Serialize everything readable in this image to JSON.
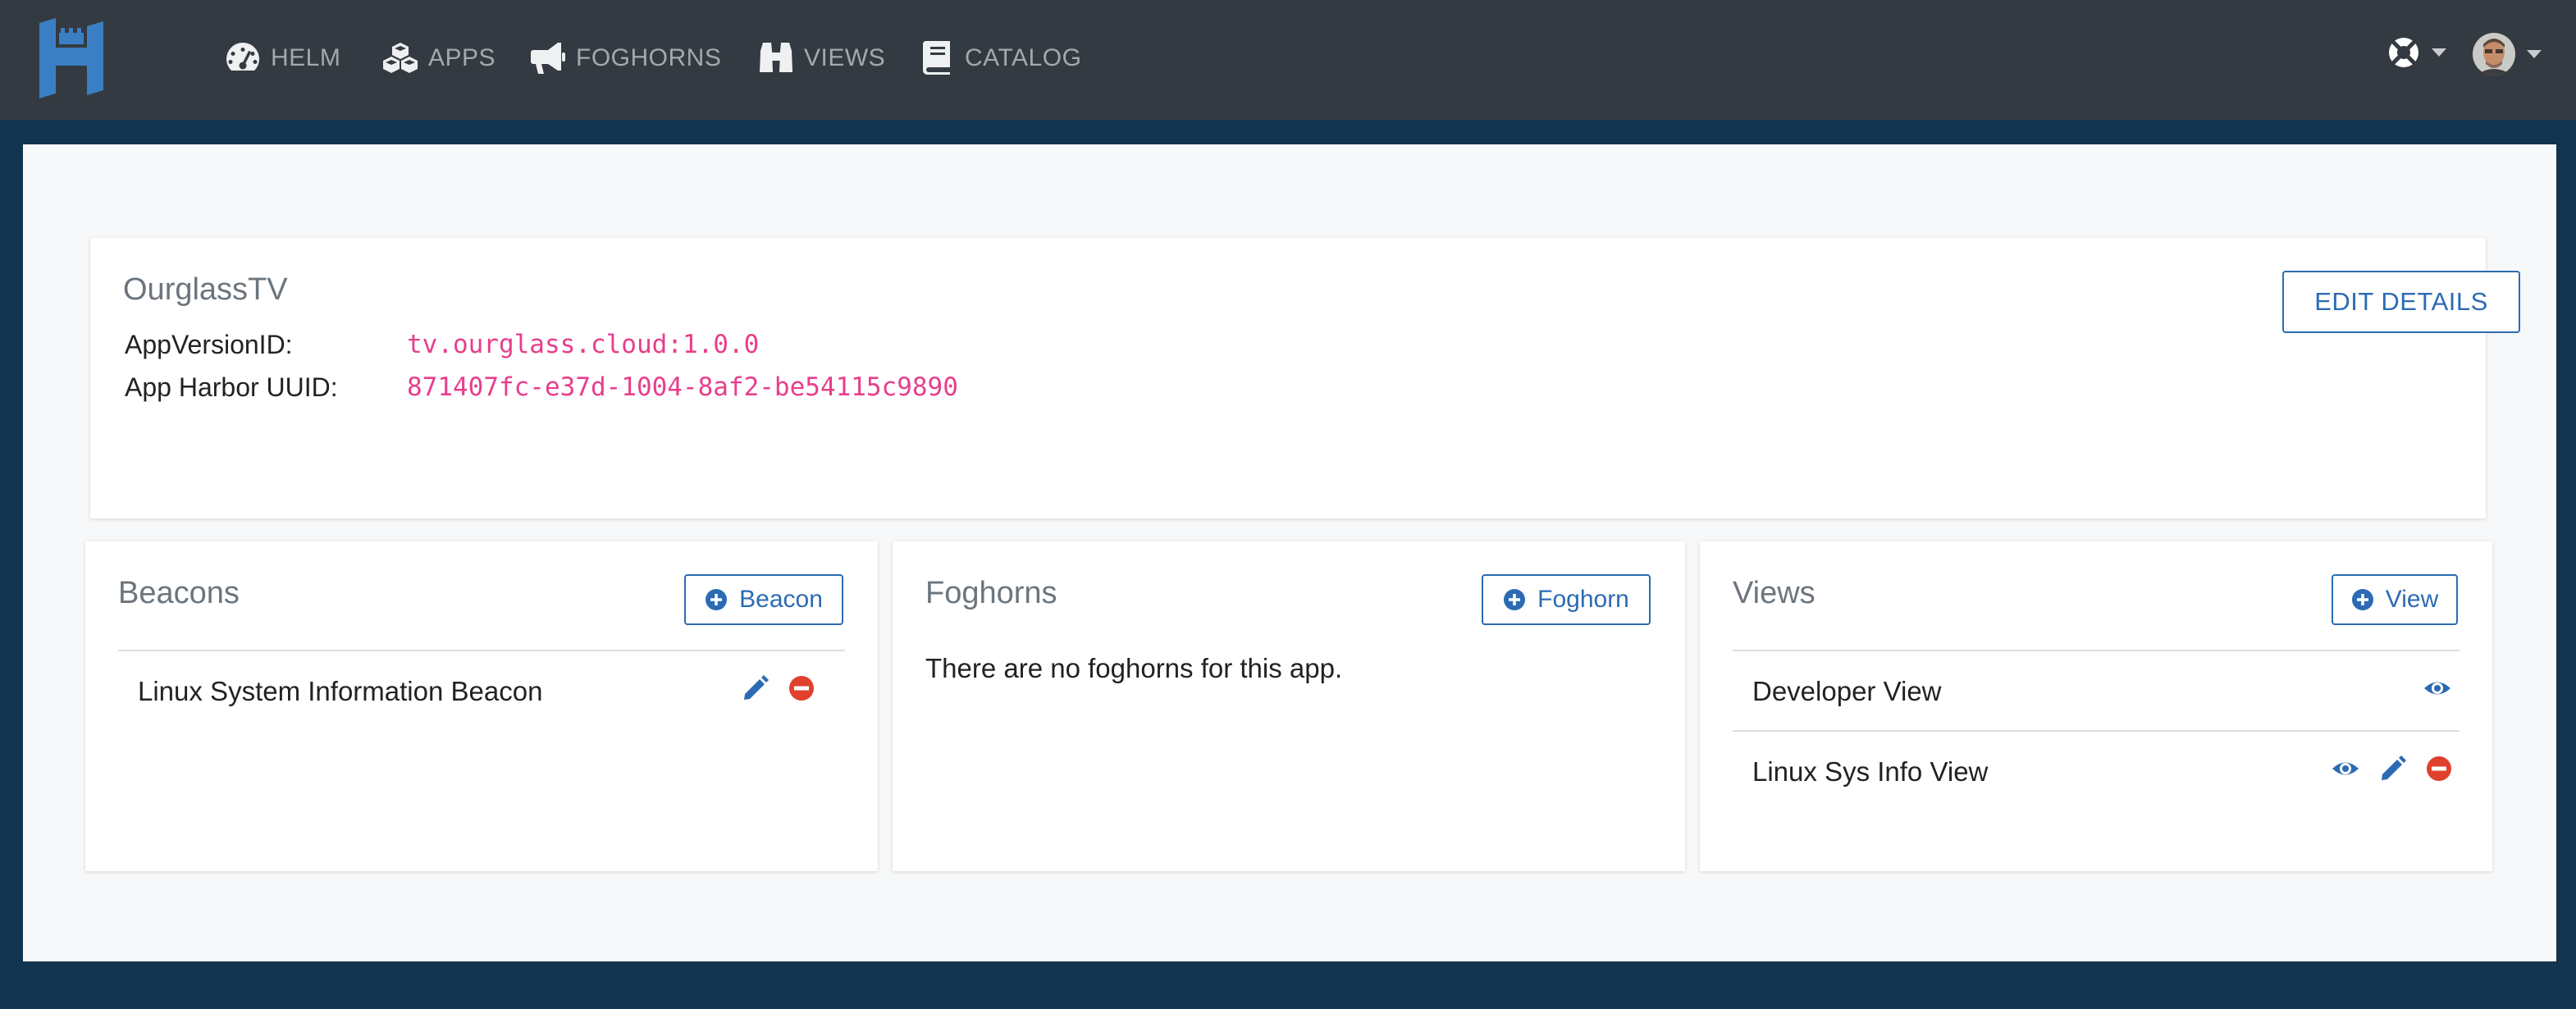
{
  "nav": {
    "items": [
      {
        "label": "HELM",
        "icon": "tachometer-icon"
      },
      {
        "label": "APPS",
        "icon": "cubes-icon"
      },
      {
        "label": "FOGHORNS",
        "icon": "bullhorn-icon"
      },
      {
        "label": "VIEWS",
        "icon": "binoculars-icon"
      },
      {
        "label": "CATALOG",
        "icon": "book-icon"
      }
    ],
    "help_icon": "life-ring-icon",
    "avatar_icon": "user-avatar"
  },
  "app": {
    "name": "OurglassTV",
    "version_label": "AppVersionID:",
    "version_value": "tv.ourglass.cloud:1.0.0",
    "uuid_label": "App Harbor UUID:",
    "uuid_value": "871407fc-e37d-1004-8af2-be54115c9890",
    "edit_button": "EDIT DETAILS"
  },
  "beacons": {
    "title": "Beacons",
    "add_label": "Beacon",
    "items": [
      {
        "name": "Linux System Information Beacon",
        "actions": [
          "edit",
          "remove"
        ]
      }
    ]
  },
  "foghorns": {
    "title": "Foghorns",
    "add_label": "Foghorn",
    "empty_text": "There are no foghorns for this app."
  },
  "views": {
    "title": "Views",
    "add_label": "View",
    "items": [
      {
        "name": "Developer View",
        "actions": [
          "view"
        ]
      },
      {
        "name": "Linux Sys Info View",
        "actions": [
          "view",
          "edit",
          "remove"
        ]
      }
    ]
  },
  "colors": {
    "navbar": "#343a41",
    "background": "#12344f",
    "accent": "#2c6bb3",
    "code": "#e83e8c",
    "danger": "#e0402e"
  }
}
